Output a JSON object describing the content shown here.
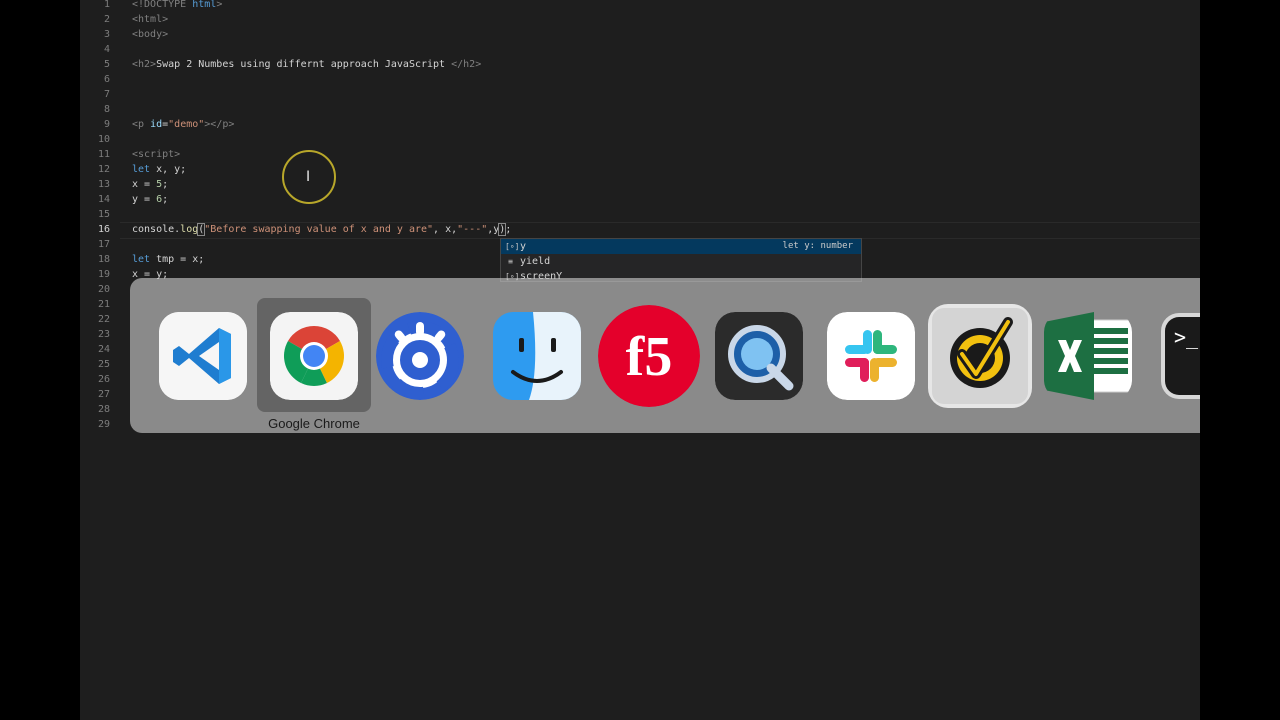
{
  "editor": {
    "line_numbers": [
      "1",
      "2",
      "3",
      "4",
      "5",
      "6",
      "7",
      "8",
      "9",
      "10",
      "11",
      "12",
      "13",
      "14",
      "15",
      "16",
      "17",
      "18",
      "19",
      "20",
      "21",
      "22",
      "23",
      "24",
      "25",
      "26",
      "27",
      "28",
      "29"
    ],
    "active_line": "16",
    "code": {
      "l1_doctype": "<!DOCTYPE",
      "l1_html": "html",
      "l2": "<html>",
      "l3": "<body>",
      "l5_open": "<h2>",
      "l5_text": "Swap 2 Numbes using differnt approach JavaScript ",
      "l5_close": "</h2>",
      "l9_open": "<p",
      "l9_attr": "id",
      "l9_eq": "=",
      "l9_val": "\"demo\"",
      "l9_close": "></p>",
      "l11": "<script>",
      "l12_kw": "let",
      "l12_rest": " x, y;",
      "l13_a": "x = ",
      "l13_n": "5",
      "l13_b": ";",
      "l14_a": "y = ",
      "l14_n": "6",
      "l14_b": ";",
      "l16_obj": "console.",
      "l16_fn": "log",
      "l16_paren": "(",
      "l16_str": "\"Before swapping value of x and y are\"",
      "l16_mid": ", x,",
      "l16_str2": "\"---\"",
      "l16_end1": ",y",
      "l16_end2": ")",
      "l16_end3": ";",
      "l18_kw": "let",
      "l18_rest": " tmp = x;",
      "l19": "x = y;"
    }
  },
  "suggestions": [
    {
      "icon": "variable-icon",
      "label": "y",
      "detail": "let y: number",
      "selected": true
    },
    {
      "icon": "keyword-icon",
      "label": "yield",
      "detail": "",
      "selected": false
    },
    {
      "icon": "variable-icon",
      "label": "screenY",
      "detail": "",
      "selected": false
    }
  ],
  "app_switcher": {
    "apps": [
      "Visual Studio Code",
      "Google Chrome",
      "Nextiva",
      "Finder",
      "F5",
      "QuickTime Player",
      "Slack",
      "Norton",
      "Microsoft Excel",
      "Terminal"
    ],
    "selected_label": "Google Chrome"
  }
}
